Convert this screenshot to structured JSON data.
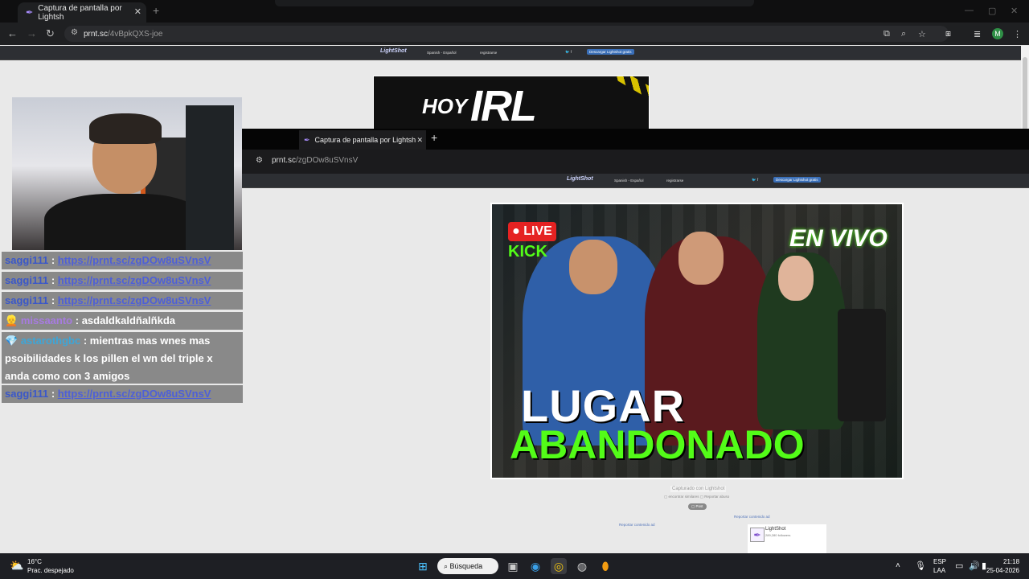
{
  "outer_browser": {
    "tab_title": "Captura de pantalla por Lightsh",
    "url_host": "prnt.sc",
    "url_path": "/4vBpkQXS-joe"
  },
  "lightshot_header": {
    "logo": "LightShot",
    "logo_sub": "screenshot tool",
    "lang": "Spanish - Español",
    "login": "registrarse",
    "download": "Descargar Lightshot gratis"
  },
  "thumb_top": {
    "word1": "HOY",
    "word2": "IRL"
  },
  "inner_browser": {
    "tab_title": "Captura de pantalla por Lightsh",
    "url_host": "prnt.sc",
    "url_path": "/zgDOw8uSVnsV"
  },
  "thumbnail": {
    "badge_live": "LIVE",
    "badge_kick": "KICK",
    "en_vivo": "EN VIVO",
    "title_line1": "LUGAR",
    "title_line2": "ABANDONADO"
  },
  "below_image": {
    "captured": "Capturado con Lightshot",
    "small_links": "▢ encontrar similares  ▢ Reportar abuso",
    "pill": "▢ Post",
    "report_link": "Reportar contenido ad",
    "left_link": "Reportar contenido ad",
    "card_title": "LightShot",
    "card_sub": "289,280 followers"
  },
  "chat": [
    {
      "user": "saggi111",
      "text": "https://prnt.sc/zgDOw8uSVnsV",
      "type": "link"
    },
    {
      "user": "saggi111",
      "text": "https://prnt.sc/zgDOw8uSVnsV",
      "type": "link"
    },
    {
      "user": "saggi111",
      "text": "https://prnt.sc/zgDOw8uSVnsV",
      "type": "link"
    },
    {
      "user": "missaanto",
      "text": "asdaldkaldñalñkda",
      "type": "text"
    },
    {
      "user": "astarothgbc",
      "text": "mientras mas wnes mas psoibilidades k los pillen el wn del triple x anda como con 3 amigos",
      "type": "text"
    },
    {
      "user": "saggi111",
      "text": "https://prnt.sc/zgDOw8uSVnsV",
      "type": "link"
    }
  ],
  "taskbar": {
    "temp": "16°C",
    "weather": "Prac. despejado",
    "search": "Búsqueda",
    "lang": "ESP",
    "layout": "LAA",
    "time": "21:18",
    "date": "25-04-2026"
  },
  "avatar_letter": "M"
}
